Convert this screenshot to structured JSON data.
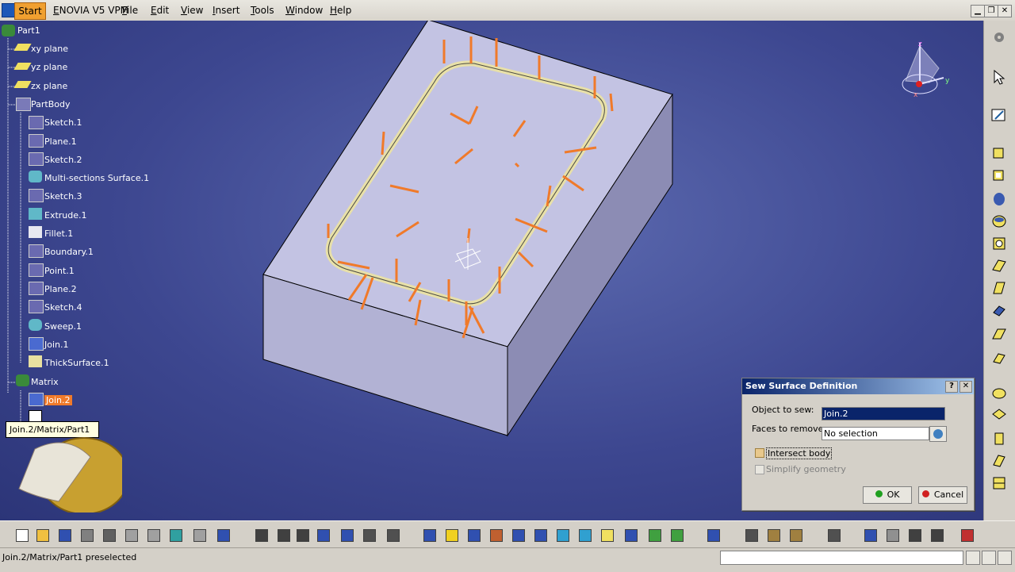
{
  "menubar": {
    "start": "Start",
    "items": [
      "ENOVIA V5 VPM",
      "File",
      "Edit",
      "View",
      "Insert",
      "Tools",
      "Window",
      "Help"
    ]
  },
  "tree": {
    "root": "Part1",
    "nodes": [
      "xy plane",
      "yz plane",
      "zx plane",
      "PartBody",
      "Sketch.1",
      "Plane.1",
      "Sketch.2",
      "Multi-sections Surface.1",
      "Sketch.3",
      "Extrude.1",
      "Fillet.1",
      "Boundary.1",
      "Point.1",
      "Plane.2",
      "Sketch.4",
      "Sweep.1",
      "Join.1",
      "ThickSurface.1",
      "Matrix",
      "Join.2"
    ],
    "tooltip": "Join.2/Matrix/Part1"
  },
  "compass": {
    "axis_x": "x",
    "axis_y": "y",
    "axis_z": "z"
  },
  "dialog": {
    "title": "Sew Surface Definition",
    "help": "?",
    "close": "✕",
    "object_label": "Object to sew:",
    "object_value": "Join.2",
    "faces_label": "Faces to remove:",
    "faces_value": "No selection",
    "intersect_label": "Intersect body",
    "simplify_label": "Simplify geometry",
    "ok": "OK",
    "cancel": "Cancel"
  },
  "statusbar": {
    "text": "Join.2/Matrix/Part1 preselected"
  },
  "icons": {
    "right_toolbar": [
      "gear-icon",
      "select-arrow-icon",
      "sketch-icon",
      "pad-icon",
      "pocket-icon",
      "shaft-icon",
      "groove-icon",
      "hole-icon",
      "rib-icon",
      "slot-icon",
      "stiffener-icon",
      "multi-section-icon",
      "remove-icon",
      "draft-icon",
      "fillet-icon",
      "chamfer-icon",
      "shell-icon",
      "thickness-icon",
      "thread-icon",
      "removal-icon"
    ],
    "bottom_toolbar": [
      "new-icon",
      "open-icon",
      "save-icon",
      "print-icon",
      "cut-icon",
      "copy-icon",
      "paste-icon",
      "undo-icon",
      "redo-icon",
      "whats-this-icon",
      "formula-icon",
      "comment-icon",
      "knowledge-icon",
      "table-icon",
      "tree-icon",
      "catalog-icon",
      "measure-icon",
      "fly-icon",
      "fit-all-icon",
      "pan-icon",
      "rotate-icon",
      "zoom-in-icon",
      "zoom-out-icon",
      "normal-view-icon",
      "views-icon",
      "render-icon",
      "hide-show-icon",
      "swap-icon",
      "edit-icon",
      "snapshot-icon",
      "spin-icon",
      "hand-icon",
      "axis-icon",
      "scale-icon",
      "catia-logo"
    ]
  },
  "colors": {
    "accent": "#f07a2a",
    "viewport": "#3d4790",
    "dialog_title": "#0a246a",
    "selection_field": "#0a246a"
  }
}
